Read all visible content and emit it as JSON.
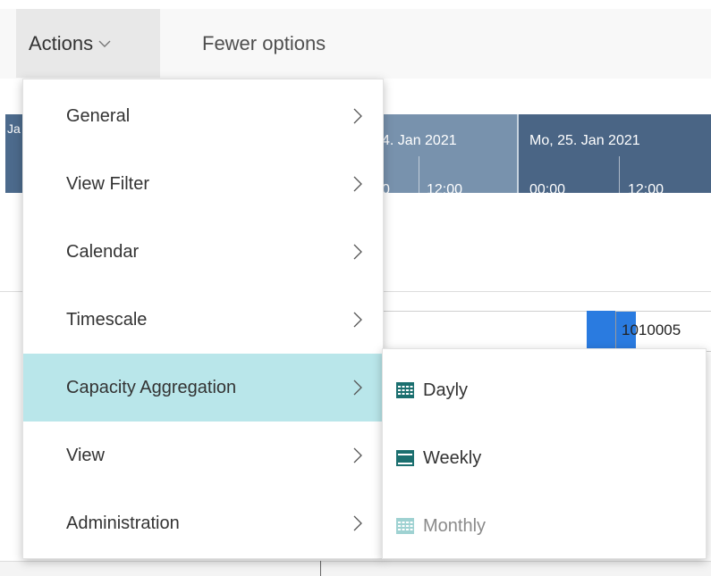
{
  "toolbar": {
    "actions_label": "Actions",
    "fewer_options_label": "Fewer options"
  },
  "gantt": {
    "partial_left_label": "Ja",
    "date_groups": [
      {
        "date": "4. Jan 2021",
        "times": [
          "0",
          "12:00"
        ]
      },
      {
        "date": "Mo, 25. Jan 2021",
        "times": [
          "00:00",
          "12:00"
        ]
      }
    ],
    "task_label": "1010005"
  },
  "menu": {
    "items": [
      {
        "label": "General"
      },
      {
        "label": "View Filter"
      },
      {
        "label": "Calendar"
      },
      {
        "label": "Timescale"
      },
      {
        "label": "Capacity Aggregation"
      },
      {
        "label": "View"
      },
      {
        "label": "Administration"
      }
    ],
    "active_item": "Capacity Aggregation"
  },
  "submenu": {
    "items": [
      {
        "label": "Dayly",
        "icon": "calendar-grid-icon",
        "color": "#1b6f6f",
        "enabled": true
      },
      {
        "label": "Weekly",
        "icon": "calendar-week-icon",
        "color": "#1b6f6f",
        "enabled": true
      },
      {
        "label": "Monthly",
        "icon": "calendar-month-icon",
        "color": "#9fd2d2",
        "enabled": false
      }
    ]
  },
  "colors": {
    "accent_active": "#b9e6ea",
    "gantt_header_dark": "#4a6585",
    "gantt_header_light": "#7892ad",
    "task_blue": "#2a7be0"
  }
}
